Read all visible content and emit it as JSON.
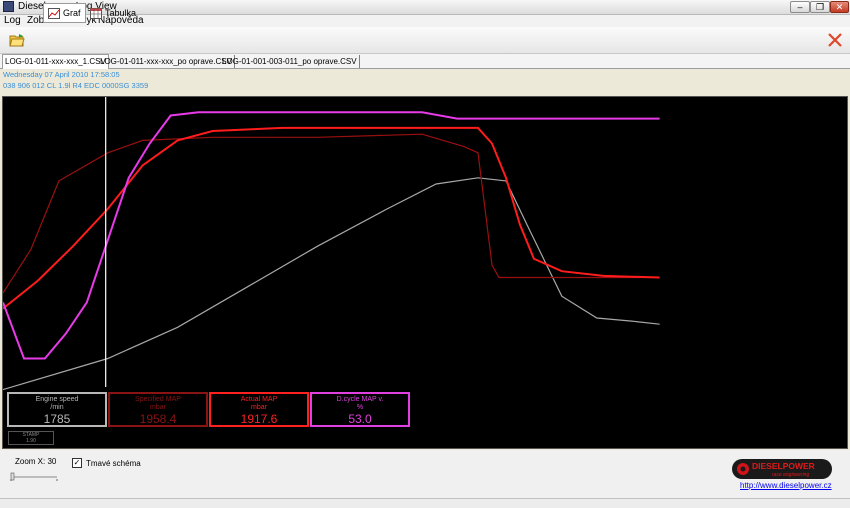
{
  "window": {
    "title": "Dieselpower Log View"
  },
  "menu": [
    "Log",
    "Zobrazení",
    "Jazyk",
    "Nápověda"
  ],
  "toolbar": {
    "graph_label": "Graf",
    "table_label": "Tabulka"
  },
  "tabs": [
    {
      "label": "LOG-01-011-xxx-xxx_1.CSV",
      "active": true
    },
    {
      "label": "LOG-01-011-xxx-xxx_po oprave.CSV",
      "active": false
    },
    {
      "label": "LOG-01-001-003-011_po oprave.CSV",
      "active": false
    }
  ],
  "info": {
    "date": "Wednesday 07 April 2010 17:58:05",
    "ecu": "038 906 012 CL  1.9l R4 EDC 0000SG  3359"
  },
  "gauges": [
    {
      "name": "Engine speed",
      "unit": "/min",
      "value": "1785",
      "color": "#b8b8b8"
    },
    {
      "name": "Specified MAP",
      "unit": "mbar",
      "value": "1958.4",
      "color": "#8a1414"
    },
    {
      "name": "Actual MAP",
      "unit": "mbar",
      "value": "1917.6",
      "color": "#ff2020"
    },
    {
      "name": "D.cycle MAP v.",
      "unit": "%",
      "value": "53.0",
      "color": "#e040e0"
    }
  ],
  "stamp": {
    "label": "STAMP",
    "value": "1.90"
  },
  "bottom": {
    "zoom_label": "Zoom X: 30",
    "dark_scheme_label": "Tmavé schéma",
    "dark_scheme_checked": true,
    "logo_text": "DIESELPOWER",
    "logo_subtext": "race engineering",
    "link": "http://www.dieselpower.cz"
  },
  "chart_data": {
    "type": "line",
    "cursor_x": 0.147,
    "series": [
      {
        "name": "Engine speed",
        "color": "#a8a8a8",
        "points": [
          [
            0,
            12
          ],
          [
            0.15,
            22
          ],
          [
            0.25,
            32
          ],
          [
            0.35,
            45
          ],
          [
            0.45,
            58
          ],
          [
            0.55,
            70
          ],
          [
            0.62,
            78
          ],
          [
            0.68,
            80
          ],
          [
            0.72,
            79
          ],
          [
            0.75,
            65
          ],
          [
            0.8,
            42
          ],
          [
            0.85,
            35
          ],
          [
            0.9,
            34
          ],
          [
            0.94,
            33
          ]
        ]
      },
      {
        "name": "Specified MAP",
        "color": "#9a1010",
        "points": [
          [
            0,
            43
          ],
          [
            0.04,
            57
          ],
          [
            0.08,
            79
          ],
          [
            0.15,
            88
          ],
          [
            0.2,
            92
          ],
          [
            0.3,
            93
          ],
          [
            0.45,
            93
          ],
          [
            0.6,
            94
          ],
          [
            0.66,
            90
          ],
          [
            0.68,
            88
          ],
          [
            0.7,
            52
          ],
          [
            0.71,
            48
          ],
          [
            0.8,
            48
          ],
          [
            0.94,
            48
          ]
        ]
      },
      {
        "name": "Actual MAP",
        "color": "#ff1c1c",
        "points": [
          [
            0,
            38
          ],
          [
            0.05,
            47
          ],
          [
            0.1,
            58
          ],
          [
            0.15,
            70
          ],
          [
            0.2,
            84
          ],
          [
            0.25,
            92
          ],
          [
            0.3,
            95
          ],
          [
            0.4,
            96
          ],
          [
            0.55,
            96
          ],
          [
            0.68,
            96
          ],
          [
            0.7,
            91
          ],
          [
            0.72,
            80
          ],
          [
            0.74,
            65
          ],
          [
            0.76,
            54
          ],
          [
            0.8,
            50
          ],
          [
            0.86,
            48.5
          ],
          [
            0.94,
            48
          ]
        ]
      },
      {
        "name": "D.cycle MAP v.",
        "color": "#e83ae8",
        "points": [
          [
            0,
            40
          ],
          [
            0.03,
            22
          ],
          [
            0.06,
            22
          ],
          [
            0.09,
            30
          ],
          [
            0.12,
            40
          ],
          [
            0.15,
            60
          ],
          [
            0.18,
            80
          ],
          [
            0.21,
            91
          ],
          [
            0.24,
            100
          ],
          [
            0.28,
            101
          ],
          [
            0.45,
            101
          ],
          [
            0.6,
            101
          ],
          [
            0.65,
            99
          ],
          [
            0.7,
            99
          ],
          [
            0.8,
            99
          ],
          [
            0.94,
            99
          ]
        ]
      }
    ]
  }
}
